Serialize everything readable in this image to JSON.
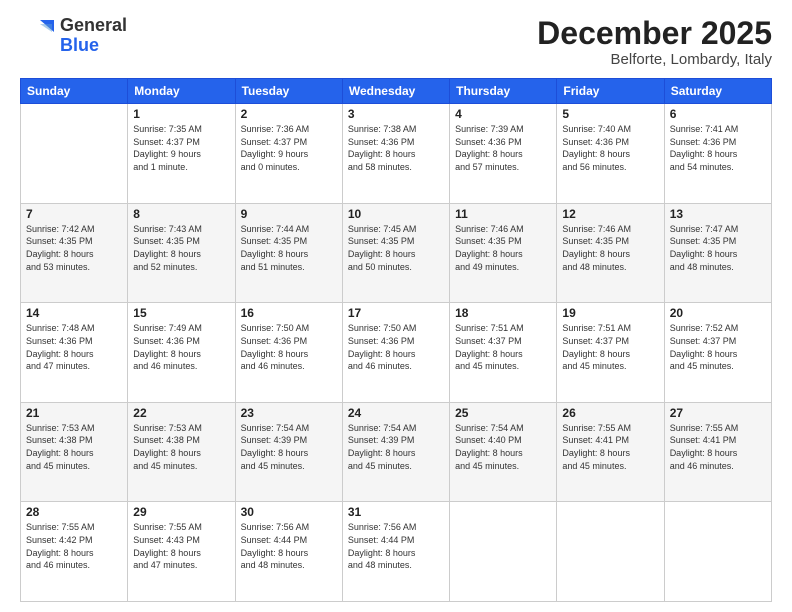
{
  "logo": {
    "general": "General",
    "blue": "Blue"
  },
  "header": {
    "month": "December 2025",
    "location": "Belforte, Lombardy, Italy"
  },
  "days_of_week": [
    "Sunday",
    "Monday",
    "Tuesday",
    "Wednesday",
    "Thursday",
    "Friday",
    "Saturday"
  ],
  "weeks": [
    [
      {
        "day": "",
        "text": ""
      },
      {
        "day": "1",
        "text": "Sunrise: 7:35 AM\nSunset: 4:37 PM\nDaylight: 9 hours\nand 1 minute."
      },
      {
        "day": "2",
        "text": "Sunrise: 7:36 AM\nSunset: 4:37 PM\nDaylight: 9 hours\nand 0 minutes."
      },
      {
        "day": "3",
        "text": "Sunrise: 7:38 AM\nSunset: 4:36 PM\nDaylight: 8 hours\nand 58 minutes."
      },
      {
        "day": "4",
        "text": "Sunrise: 7:39 AM\nSunset: 4:36 PM\nDaylight: 8 hours\nand 57 minutes."
      },
      {
        "day": "5",
        "text": "Sunrise: 7:40 AM\nSunset: 4:36 PM\nDaylight: 8 hours\nand 56 minutes."
      },
      {
        "day": "6",
        "text": "Sunrise: 7:41 AM\nSunset: 4:36 PM\nDaylight: 8 hours\nand 54 minutes."
      }
    ],
    [
      {
        "day": "7",
        "text": "Sunrise: 7:42 AM\nSunset: 4:35 PM\nDaylight: 8 hours\nand 53 minutes."
      },
      {
        "day": "8",
        "text": "Sunrise: 7:43 AM\nSunset: 4:35 PM\nDaylight: 8 hours\nand 52 minutes."
      },
      {
        "day": "9",
        "text": "Sunrise: 7:44 AM\nSunset: 4:35 PM\nDaylight: 8 hours\nand 51 minutes."
      },
      {
        "day": "10",
        "text": "Sunrise: 7:45 AM\nSunset: 4:35 PM\nDaylight: 8 hours\nand 50 minutes."
      },
      {
        "day": "11",
        "text": "Sunrise: 7:46 AM\nSunset: 4:35 PM\nDaylight: 8 hours\nand 49 minutes."
      },
      {
        "day": "12",
        "text": "Sunrise: 7:46 AM\nSunset: 4:35 PM\nDaylight: 8 hours\nand 48 minutes."
      },
      {
        "day": "13",
        "text": "Sunrise: 7:47 AM\nSunset: 4:35 PM\nDaylight: 8 hours\nand 48 minutes."
      }
    ],
    [
      {
        "day": "14",
        "text": "Sunrise: 7:48 AM\nSunset: 4:36 PM\nDaylight: 8 hours\nand 47 minutes."
      },
      {
        "day": "15",
        "text": "Sunrise: 7:49 AM\nSunset: 4:36 PM\nDaylight: 8 hours\nand 46 minutes."
      },
      {
        "day": "16",
        "text": "Sunrise: 7:50 AM\nSunset: 4:36 PM\nDaylight: 8 hours\nand 46 minutes."
      },
      {
        "day": "17",
        "text": "Sunrise: 7:50 AM\nSunset: 4:36 PM\nDaylight: 8 hours\nand 46 minutes."
      },
      {
        "day": "18",
        "text": "Sunrise: 7:51 AM\nSunset: 4:37 PM\nDaylight: 8 hours\nand 45 minutes."
      },
      {
        "day": "19",
        "text": "Sunrise: 7:51 AM\nSunset: 4:37 PM\nDaylight: 8 hours\nand 45 minutes."
      },
      {
        "day": "20",
        "text": "Sunrise: 7:52 AM\nSunset: 4:37 PM\nDaylight: 8 hours\nand 45 minutes."
      }
    ],
    [
      {
        "day": "21",
        "text": "Sunrise: 7:53 AM\nSunset: 4:38 PM\nDaylight: 8 hours\nand 45 minutes."
      },
      {
        "day": "22",
        "text": "Sunrise: 7:53 AM\nSunset: 4:38 PM\nDaylight: 8 hours\nand 45 minutes."
      },
      {
        "day": "23",
        "text": "Sunrise: 7:54 AM\nSunset: 4:39 PM\nDaylight: 8 hours\nand 45 minutes."
      },
      {
        "day": "24",
        "text": "Sunrise: 7:54 AM\nSunset: 4:39 PM\nDaylight: 8 hours\nand 45 minutes."
      },
      {
        "day": "25",
        "text": "Sunrise: 7:54 AM\nSunset: 4:40 PM\nDaylight: 8 hours\nand 45 minutes."
      },
      {
        "day": "26",
        "text": "Sunrise: 7:55 AM\nSunset: 4:41 PM\nDaylight: 8 hours\nand 45 minutes."
      },
      {
        "day": "27",
        "text": "Sunrise: 7:55 AM\nSunset: 4:41 PM\nDaylight: 8 hours\nand 46 minutes."
      }
    ],
    [
      {
        "day": "28",
        "text": "Sunrise: 7:55 AM\nSunset: 4:42 PM\nDaylight: 8 hours\nand 46 minutes."
      },
      {
        "day": "29",
        "text": "Sunrise: 7:55 AM\nSunset: 4:43 PM\nDaylight: 8 hours\nand 47 minutes."
      },
      {
        "day": "30",
        "text": "Sunrise: 7:56 AM\nSunset: 4:44 PM\nDaylight: 8 hours\nand 48 minutes."
      },
      {
        "day": "31",
        "text": "Sunrise: 7:56 AM\nSunset: 4:44 PM\nDaylight: 8 hours\nand 48 minutes."
      },
      {
        "day": "",
        "text": ""
      },
      {
        "day": "",
        "text": ""
      },
      {
        "day": "",
        "text": ""
      }
    ]
  ]
}
